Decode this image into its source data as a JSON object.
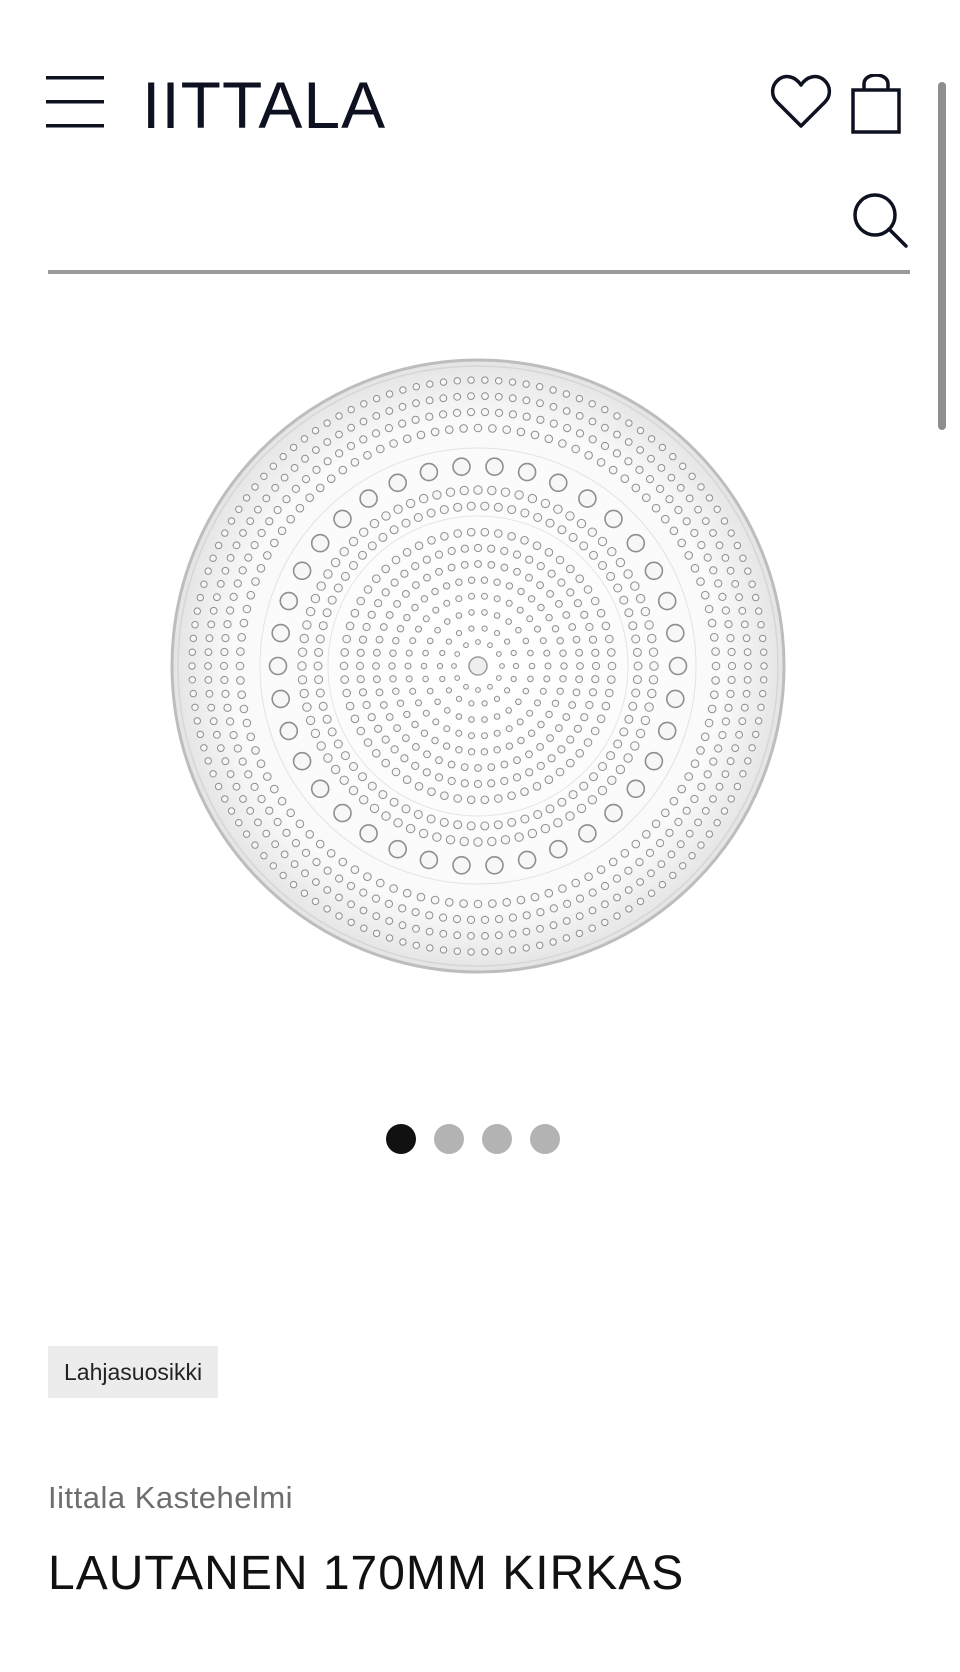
{
  "header": {
    "logo_text": "IITTALA",
    "menu_icon": "hamburger-menu-icon",
    "favorites_icon": "heart-icon",
    "bag_icon": "shopping-bag-icon",
    "brand_color": "#0e1120"
  },
  "search": {
    "value": "",
    "placeholder": "",
    "icon": "search-icon",
    "underline_color": "#9a9a9a"
  },
  "gallery": {
    "image": "clear-glass-plate-kastehelmi",
    "dots_total": 4,
    "active_index": 0
  },
  "product": {
    "badge": "Lahjasuosikki",
    "brand_collection": "Iittala Kastehelmi",
    "title": "LAUTANEN 170MM KIRKAS"
  }
}
